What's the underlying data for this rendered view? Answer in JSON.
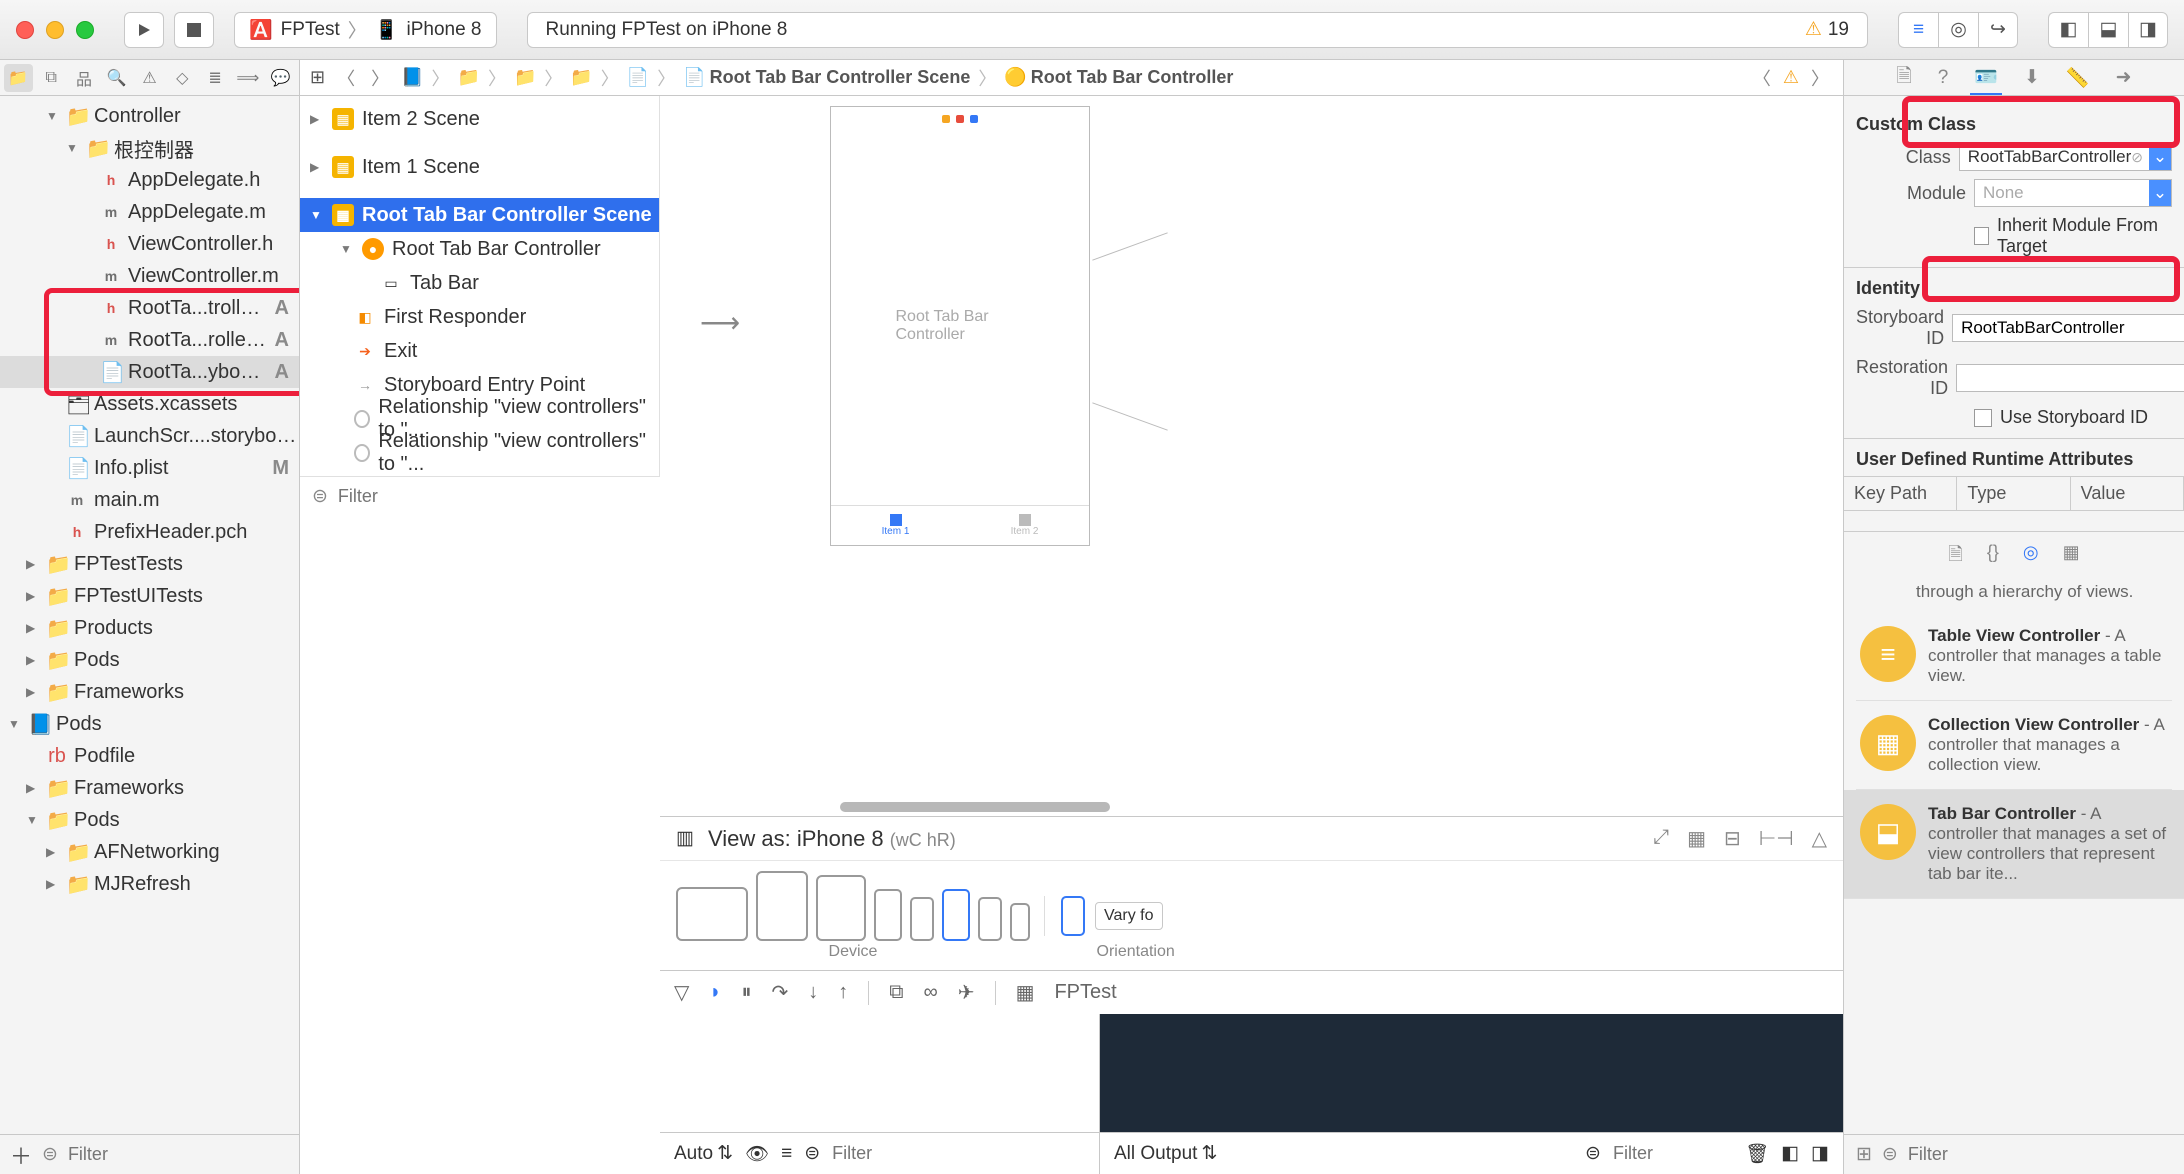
{
  "titlebar": {
    "scheme_target": "FPTest",
    "scheme_device": "iPhone 8",
    "status": "Running FPTest on iPhone 8",
    "warning_count": "19"
  },
  "navigator": {
    "filter_placeholder": "Filter",
    "tree": {
      "controller": "Controller",
      "root_ctrl": "根控制器",
      "files": {
        "appdelegate_h": "AppDelegate.h",
        "appdelegate_m": "AppDelegate.m",
        "viewcontroller_h": "ViewController.h",
        "viewcontroller_m": "ViewController.m",
        "roottab_h": "RootTa...troller.h",
        "roottab_m": "RootTa...roller.m",
        "roottab_sb": "RootTa...yboard",
        "assets": "Assets.xcassets",
        "launch_sb": "LaunchScr....storyboard",
        "info_plist": "Info.plist",
        "main_m": "main.m",
        "prefix_pch": "PrefixHeader.pch"
      },
      "badges": {
        "a": "A",
        "m": "M"
      },
      "groups": {
        "tests": "FPTestTests",
        "uitests": "FPTestUITests",
        "products": "Products",
        "pods": "Pods",
        "frameworks": "Frameworks"
      },
      "pods_proj": "Pods",
      "podfile": "Podfile",
      "frameworks2": "Frameworks",
      "pods_group": "Pods",
      "afnetworking": "AFNetworking",
      "mjrefresh": "MJRefresh"
    }
  },
  "jumpbar": {
    "scene": "Root Tab Bar Controller Scene",
    "controller": "Root Tab Bar Controller"
  },
  "outline": {
    "item2": "Item 2 Scene",
    "item1": "Item 1 Scene",
    "root_scene": "Root Tab Bar Controller Scene",
    "root_vc": "Root Tab Bar Controller",
    "tab_bar": "Tab Bar",
    "first_responder": "First Responder",
    "exit": "Exit",
    "entry": "Storyboard Entry Point",
    "rel1": "Relationship \"view controllers\" to \"...",
    "rel2": "Relationship \"view controllers\" to \"...",
    "filter_placeholder": "Filter"
  },
  "canvas": {
    "device_label": "Root Tab Bar Controller",
    "tab1": "Item 1",
    "tab2": "Item 2"
  },
  "viewas": {
    "title": "View as: iPhone 8",
    "sub": "(wC hR)",
    "device_label": "Device",
    "orientation_label": "Orientation",
    "vary": "Vary fo"
  },
  "debug": {
    "target": "FPTest",
    "auto": "Auto",
    "filter_placeholder": "Filter",
    "console_select": "All Output",
    "console_filter": "Filter"
  },
  "inspector": {
    "custom_class": "Custom Class",
    "class_label": "Class",
    "class_value": "RootTabBarController",
    "module_label": "Module",
    "module_value": "None",
    "inherit": "Inherit Module From Target",
    "identity": "Identity",
    "storyboard_id_label": "Storyboard ID",
    "storyboard_id_value": "RootTabBarController",
    "restoration_label": "Restoration ID",
    "use_sb_id": "Use Storyboard ID",
    "runtime": "User Defined Runtime Attributes",
    "keypath": "Key Path",
    "type": "Type",
    "value": "Value",
    "lib": {
      "partial": "through a hierarchy of views.",
      "tvc_title": "Table View Controller",
      "tvc_desc": " - A controller that manages a table view.",
      "cvc_title": "Collection View Controller",
      "cvc_desc": " - A controller that manages a collection view.",
      "tbc_title": "Tab Bar Controller",
      "tbc_desc": " - A controller that manages a set of view controllers that represent tab bar ite..."
    },
    "filter_placeholder": "Filter"
  }
}
